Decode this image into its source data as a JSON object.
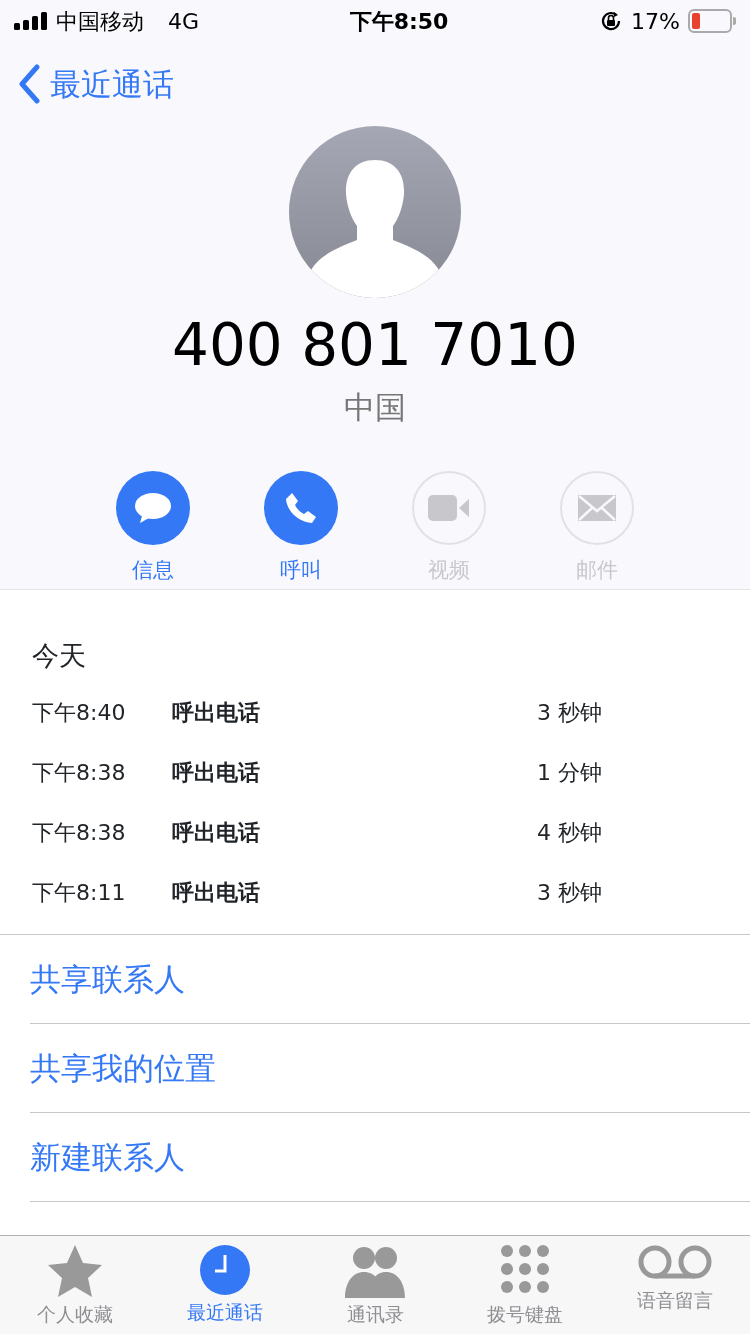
{
  "status_bar": {
    "carrier": "中国移动",
    "network": "4G",
    "time": "下午8:50",
    "battery": "17%"
  },
  "nav": {
    "back": "最近通话"
  },
  "contact": {
    "number": "400 801 7010",
    "location": "中国"
  },
  "actions": [
    {
      "kind": "message",
      "label": "信息",
      "disabled": false
    },
    {
      "kind": "call",
      "label": "呼叫",
      "disabled": false
    },
    {
      "kind": "video",
      "label": "视频",
      "disabled": true
    },
    {
      "kind": "mail",
      "label": "邮件",
      "disabled": true
    }
  ],
  "calls": {
    "heading": "今天",
    "rows": [
      {
        "time": "下午8:40",
        "type": "呼出电话",
        "duration": "3 秒钟"
      },
      {
        "time": "下午8:38",
        "type": "呼出电话",
        "duration": "1 分钟"
      },
      {
        "time": "下午8:38",
        "type": "呼出电话",
        "duration": "4 秒钟"
      },
      {
        "time": "下午8:11",
        "type": "呼出电话",
        "duration": "3 秒钟"
      }
    ]
  },
  "links": [
    "共享联系人",
    "共享我的位置",
    "新建联系人"
  ],
  "tabs": [
    {
      "kind": "favorites",
      "label": "个人收藏",
      "selected": false
    },
    {
      "kind": "recents",
      "label": "最近通话",
      "selected": true
    },
    {
      "kind": "contacts",
      "label": "通讯录",
      "selected": false
    },
    {
      "kind": "keypad",
      "label": "拨号键盘",
      "selected": false
    },
    {
      "kind": "voicemail",
      "label": "语音留言",
      "selected": false
    }
  ]
}
